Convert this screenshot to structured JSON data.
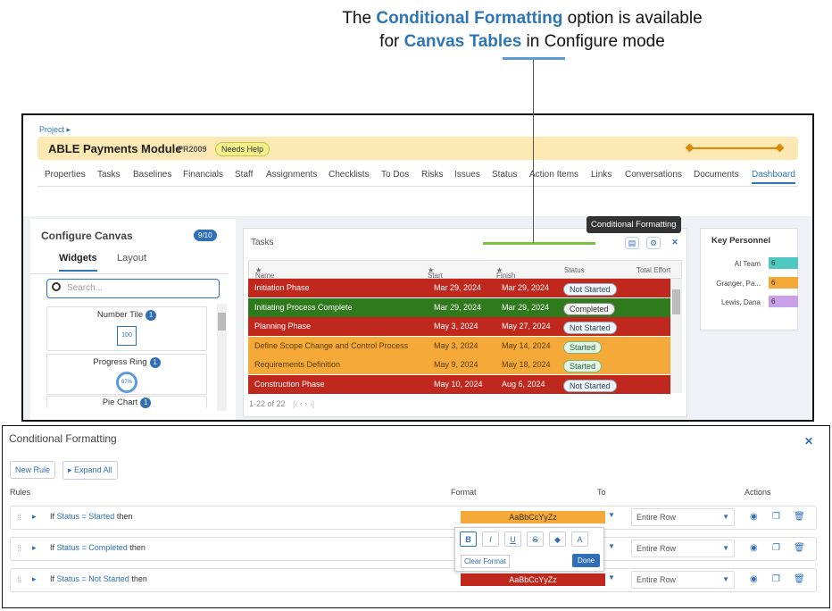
{
  "caption": {
    "l1_a": "The ",
    "l1_b": "Conditional Formatting",
    "l1_c": " option is available",
    "l2_a": "for ",
    "l2_b": "Canvas Tables",
    "l2_c": " in Configure mode"
  },
  "breadcrumb": "Project",
  "project": {
    "title": "ABLE Payments Module",
    "id": "PR2009",
    "status": "Needs Help"
  },
  "nav": [
    "Properties",
    "Tasks",
    "Baselines",
    "Financials",
    "Staff",
    "Assignments",
    "Checklists",
    "To Dos",
    "Risks",
    "Issues",
    "Status",
    "Action Items",
    "Links",
    "Conversations",
    "Documents",
    "Dashboard"
  ],
  "configure": {
    "title": "Configure Canvas",
    "count": "9/10",
    "tabs": [
      "Widgets",
      "Layout"
    ],
    "search_placeholder": "Search...",
    "widgets": [
      {
        "label": "Number Tile",
        "badge": "1",
        "preview": "100"
      },
      {
        "label": "Progress Ring",
        "badge": "1",
        "preview": "67%"
      },
      {
        "label": "Pie Chart",
        "badge": "1"
      }
    ]
  },
  "tasks": {
    "title": "Tasks",
    "tooltip": "Conditional Formatting",
    "headers": [
      "Name",
      "Start",
      "Finish",
      "Status",
      "Total Effort"
    ],
    "rows": [
      {
        "name": "Initiation Phase",
        "start": "Mar 29, 2024",
        "finish": "Mar 29, 2024",
        "status": "Not Started",
        "color": "#c0281e"
      },
      {
        "name": "Initiating Process Complete",
        "start": "Mar 29, 2024",
        "finish": "Mar 29, 2024",
        "status": "Completed",
        "color": "#2f7a1c"
      },
      {
        "name": "Planning Phase",
        "start": "May 3, 2024",
        "finish": "May 27, 2024",
        "status": "Not Started",
        "color": "#c0281e"
      },
      {
        "name": "Define Scope Change and Control Process",
        "start": "May 3, 2024",
        "finish": "May 14, 2024",
        "status": "Started",
        "color": "#f5a938"
      },
      {
        "name": "Requirements Definition",
        "start": "May 9, 2024",
        "finish": "May 18, 2024",
        "status": "Started",
        "color": "#f5a938"
      },
      {
        "name": "Construction Phase",
        "start": "May 10, 2024",
        "finish": "Aug 6, 2024",
        "status": "Not Started",
        "color": "#c0281e"
      }
    ],
    "pager": "1-22 of 22"
  },
  "key_personnel": {
    "title": "Key Personnel",
    "people": [
      {
        "name": "AI Team",
        "value": "6",
        "color": "#4fc8c0"
      },
      {
        "name": "Granger, Pa...",
        "value": "6",
        "color": "#f5a938"
      },
      {
        "name": "Lewis, Dana",
        "value": "6",
        "color": "#c9a0e8"
      }
    ]
  },
  "cf": {
    "title": "Conditional Formatting",
    "new_rule": "New Rule",
    "expand_all": "Expand All",
    "col_rules": "Rules",
    "col_format": "Format",
    "col_to": "To",
    "col_actions": "Actions",
    "rules": [
      {
        "if": "If ",
        "field": "Status = Started",
        "then": " then",
        "sample": "AaBbCcYyZz",
        "fmt_color": "#f5a938",
        "text_color": "#333",
        "to": "Entire Row"
      },
      {
        "if": "If ",
        "field": "Status = Completed",
        "then": " then",
        "sample": "",
        "fmt_color": "#ffffff",
        "text_color": "#333",
        "to": "Entire Row"
      },
      {
        "if": "If ",
        "field": "Status = Not Started",
        "then": " then",
        "sample": "AaBbCcYyZz",
        "fmt_color": "#c0281e",
        "text_color": "#ffffff",
        "to": "Entire Row"
      }
    ],
    "popup": {
      "buttons": [
        "B",
        "I",
        "U",
        "S",
        "◆",
        "A"
      ],
      "clear": "Clear Format",
      "done": "Done"
    }
  }
}
